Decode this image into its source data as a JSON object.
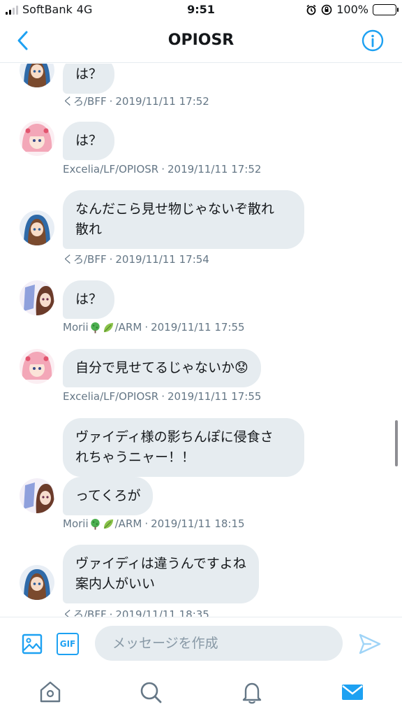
{
  "status_bar": {
    "carrier": "SoftBank",
    "network": "4G",
    "time": "9:51",
    "battery": "100%",
    "battery_color": "#34c759"
  },
  "header": {
    "title": "OPIOSR",
    "back_icon": "chevron-left-icon",
    "info_icon": "info-icon",
    "accent": "#1da1f2"
  },
  "messages": [
    {
      "text": "は？",
      "sender": "くろ/BFF",
      "time": "2019/11/11 17:52",
      "avatar": "avatar-kuro"
    },
    {
      "text": "は？",
      "sender": "Excelia/LF/OPIOSR",
      "time": "2019/11/11 17:52",
      "avatar": "avatar-excelia"
    },
    {
      "text": "なんだこら見せ物じゃないぞ散れ散れ",
      "line1": "なんだこら見せ物じゃないぞ散れ",
      "line2": "散れ",
      "sender": "くろ/BFF",
      "time": "2019/11/11 17:54",
      "avatar": "avatar-kuro"
    },
    {
      "text": "は？",
      "sender_prefix": "Morii",
      "sender_suffix": "/ARM",
      "time": "2019/11/11 17:55",
      "avatar": "avatar-morii"
    },
    {
      "text": "自分で見せてるじゃないか",
      "emoji": "😟",
      "sender": "Excelia/LF/OPIOSR",
      "time": "2019/11/11 17:55",
      "avatar": "avatar-excelia"
    },
    {
      "text": "ヴァイディ様の影ちんぽに侵食されちゃうニャー！！",
      "line1": "ヴァイディ様の影ちんぽに侵食さ",
      "line2": "れちゃうニャー！！"
    },
    {
      "text": "ってくろが",
      "sender_prefix": "Morii",
      "sender_suffix": "/ARM",
      "time": "2019/11/11 18:15",
      "avatar": "avatar-morii"
    },
    {
      "text": "ヴァイディは違うんですよね案内人がいい",
      "line1": "ヴァイディは違うんですよね",
      "line2": "案内人がいい",
      "sender": "くろ/BFF",
      "time": "2019/11/11 18:35",
      "avatar": "avatar-kuro"
    }
  ],
  "composer": {
    "placeholder": "メッセージを作成",
    "gif_label": "GIF"
  },
  "tabbar": [
    "home-icon",
    "search-icon",
    "bell-icon",
    "mail-icon"
  ]
}
